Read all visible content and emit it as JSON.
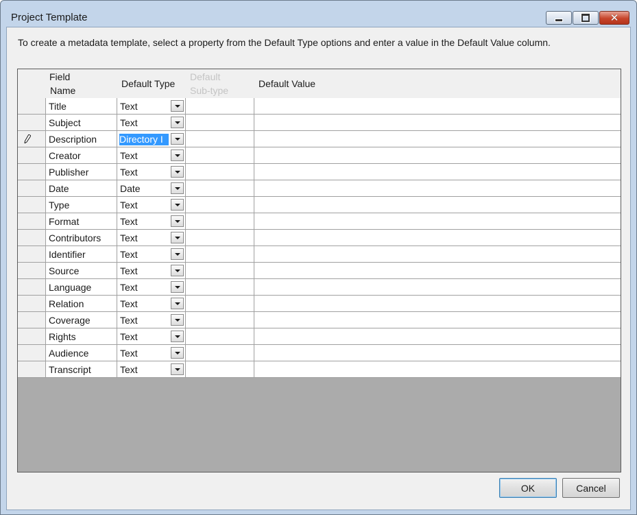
{
  "window": {
    "title": "Project Template"
  },
  "instructions": "To create a metadata template, select a property from the Default Type options and enter a value in the Default Value column.",
  "grid": {
    "headers": {
      "field_name_line1": "Field",
      "field_name_line2": "Name",
      "default_type": "Default Type",
      "default_subtype_line1": "Default",
      "default_subtype_line2": "Sub-type",
      "default_value": "Default Value"
    },
    "rows": [
      {
        "field": "Title",
        "type": "Text",
        "subtype": "",
        "value": ""
      },
      {
        "field": "Subject",
        "type": "Text",
        "subtype": "",
        "value": ""
      },
      {
        "field": "Description",
        "type": "Directory I",
        "subtype": "",
        "value": "",
        "editing": true
      },
      {
        "field": "Creator",
        "type": "Text",
        "subtype": "",
        "value": ""
      },
      {
        "field": "Publisher",
        "type": "Text",
        "subtype": "",
        "value": ""
      },
      {
        "field": "Date",
        "type": "Date",
        "subtype": "",
        "value": ""
      },
      {
        "field": "Type",
        "type": "Text",
        "subtype": "",
        "value": ""
      },
      {
        "field": "Format",
        "type": "Text",
        "subtype": "",
        "value": ""
      },
      {
        "field": "Contributors",
        "type": "Text",
        "subtype": "",
        "value": ""
      },
      {
        "field": "Identifier",
        "type": "Text",
        "subtype": "",
        "value": ""
      },
      {
        "field": "Source",
        "type": "Text",
        "subtype": "",
        "value": ""
      },
      {
        "field": "Language",
        "type": "Text",
        "subtype": "",
        "value": ""
      },
      {
        "field": "Relation",
        "type": "Text",
        "subtype": "",
        "value": ""
      },
      {
        "field": "Coverage",
        "type": "Text",
        "subtype": "",
        "value": ""
      },
      {
        "field": "Rights",
        "type": "Text",
        "subtype": "",
        "value": ""
      },
      {
        "field": "Audience",
        "type": "Text",
        "subtype": "",
        "value": ""
      },
      {
        "field": "Transcript",
        "type": "Text",
        "subtype": "",
        "value": ""
      }
    ]
  },
  "buttons": {
    "ok": "OK",
    "cancel": "Cancel"
  },
  "icons": {
    "minimize": "minimize-icon",
    "maximize": "maximize-icon",
    "close": "close-icon",
    "edit_row": "pencil-icon",
    "dropdown": "chevron-down-icon"
  },
  "colors": {
    "selection": "#3399ff",
    "close_button": "#c7452b",
    "window_frame": "#c3d5ea",
    "grid_empty": "#ababab"
  }
}
